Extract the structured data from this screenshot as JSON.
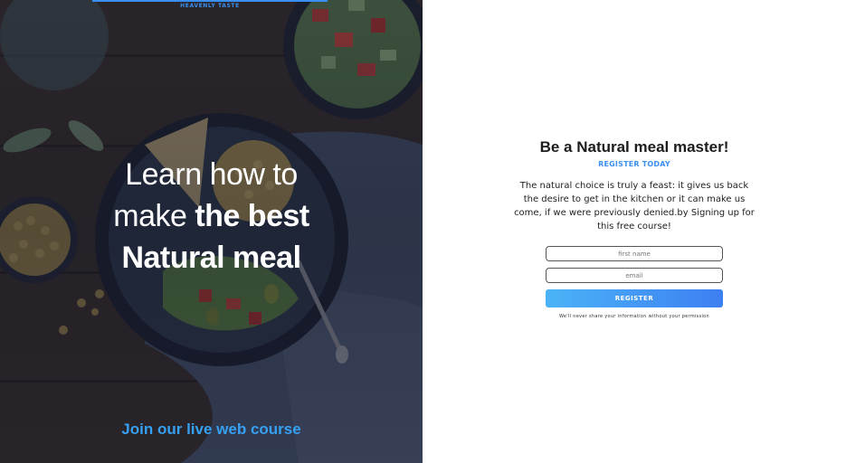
{
  "brand": {
    "name": "HEAVENLY TASTE",
    "accent_color": "#3a8ff0"
  },
  "hero": {
    "headline_line1": "Learn how to",
    "headline_line2_light": "make",
    "headline_line2_bold": "the best",
    "headline_line3": "Natural meal",
    "course_link": "Join our live web course",
    "background": "food-bowl-photo"
  },
  "signup": {
    "title": "Be a Natural meal master!",
    "subtitle": "REGISTER TODAY",
    "description": "The natural choice is truly a feast: it gives us back the desire to get in the kitchen or it can make us come, if we were previously denied.by Signing up for this free course!",
    "first_name_placeholder": "first name",
    "email_placeholder": "email",
    "register_label": "REGISTER",
    "privacy_note": "We'll never share your information without your permission"
  }
}
